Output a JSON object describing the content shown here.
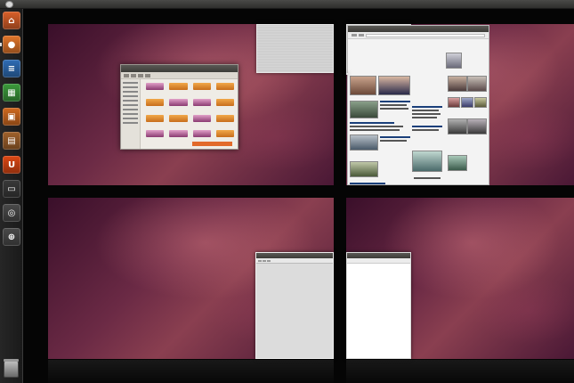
{
  "top_panel": {},
  "launcher": {
    "items": [
      {
        "name": "home-folder-icon",
        "color": "#d9602a",
        "glyph": "⌂",
        "running": false
      },
      {
        "name": "firefox-icon",
        "color": "#e2762b",
        "glyph": "●",
        "running": true
      },
      {
        "name": "writer-icon",
        "color": "#2f6db5",
        "glyph": "≡",
        "running": false
      },
      {
        "name": "calc-icon",
        "color": "#3c9a3c",
        "glyph": "▦",
        "running": false
      },
      {
        "name": "impress-icon",
        "color": "#d06a20",
        "glyph": "▣",
        "running": false
      },
      {
        "name": "software-center-icon",
        "color": "#a0622c",
        "glyph": "▤",
        "running": false
      },
      {
        "name": "ubuntu-one-icon",
        "color": "#dd4814",
        "glyph": "U",
        "running": false
      },
      {
        "name": "terminal-icon",
        "color": "#3a3a3a",
        "glyph": "▭",
        "running": false
      },
      {
        "name": "workspace-switcher-icon",
        "color": "#4a4a4a",
        "glyph": "◎",
        "running": false
      },
      {
        "name": "dash-search-icon",
        "color": "#4a4a4a",
        "glyph": "⊕",
        "running": false
      }
    ]
  },
  "workspaces": [
    {
      "id": "workspace-1"
    },
    {
      "id": "workspace-2"
    },
    {
      "id": "workspace-3"
    },
    {
      "id": "workspace-4"
    }
  ],
  "colors": {
    "wallpaper_dark": "#3a0f2a",
    "wallpaper_mid": "#8a3f50",
    "ubuntu_orange": "#dd4814",
    "workspace_gap": "#050505"
  }
}
